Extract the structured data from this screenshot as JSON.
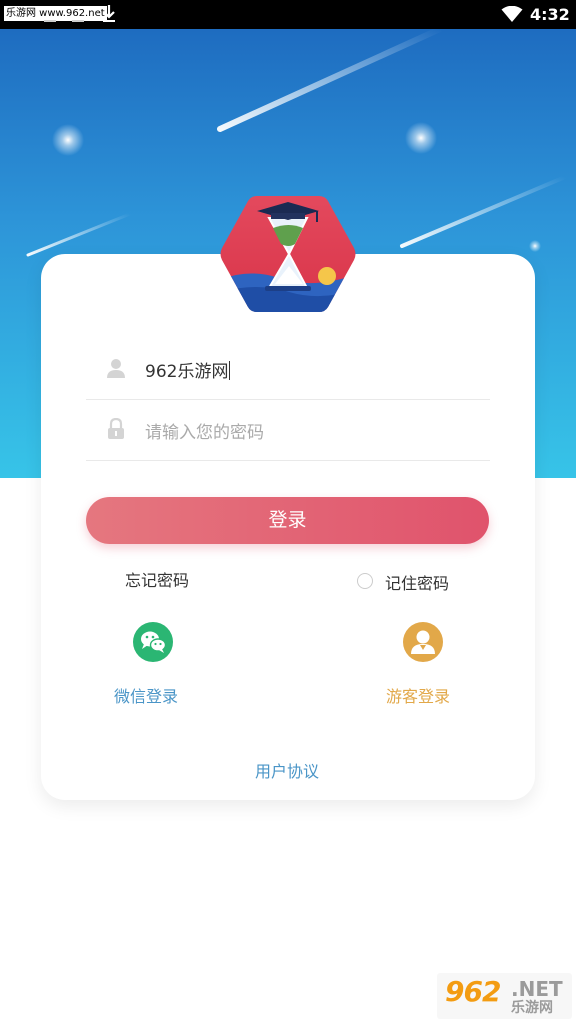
{
  "status_bar": {
    "watermark": "乐游网 www.962.net",
    "time": "4:32"
  },
  "login_form": {
    "username_value": "962乐游网",
    "password_placeholder": "请输入您的密码",
    "login_label": "登录",
    "forgot_password": "忘记密码",
    "remember_password": "记住密码",
    "remember_checked": false
  },
  "social_login": {
    "wechat_label": "微信登录",
    "guest_label": "游客登录"
  },
  "footer": {
    "user_agreement": "用户协议"
  },
  "watermark_brand": {
    "number": "962",
    "suffix": ".NET",
    "name": "乐游网"
  },
  "colors": {
    "hero_top": "#1e6cc0",
    "hero_bottom": "#37c4e8",
    "primary": "#e0536c",
    "wechat": "#2bb673",
    "guest": "#e2a849",
    "link_blue": "#4a95c7"
  },
  "icons": {
    "user": "user-icon",
    "lock": "lock-icon",
    "wechat": "wechat-icon",
    "guest": "guest-icon",
    "logo": "hourglass-logo-icon"
  }
}
